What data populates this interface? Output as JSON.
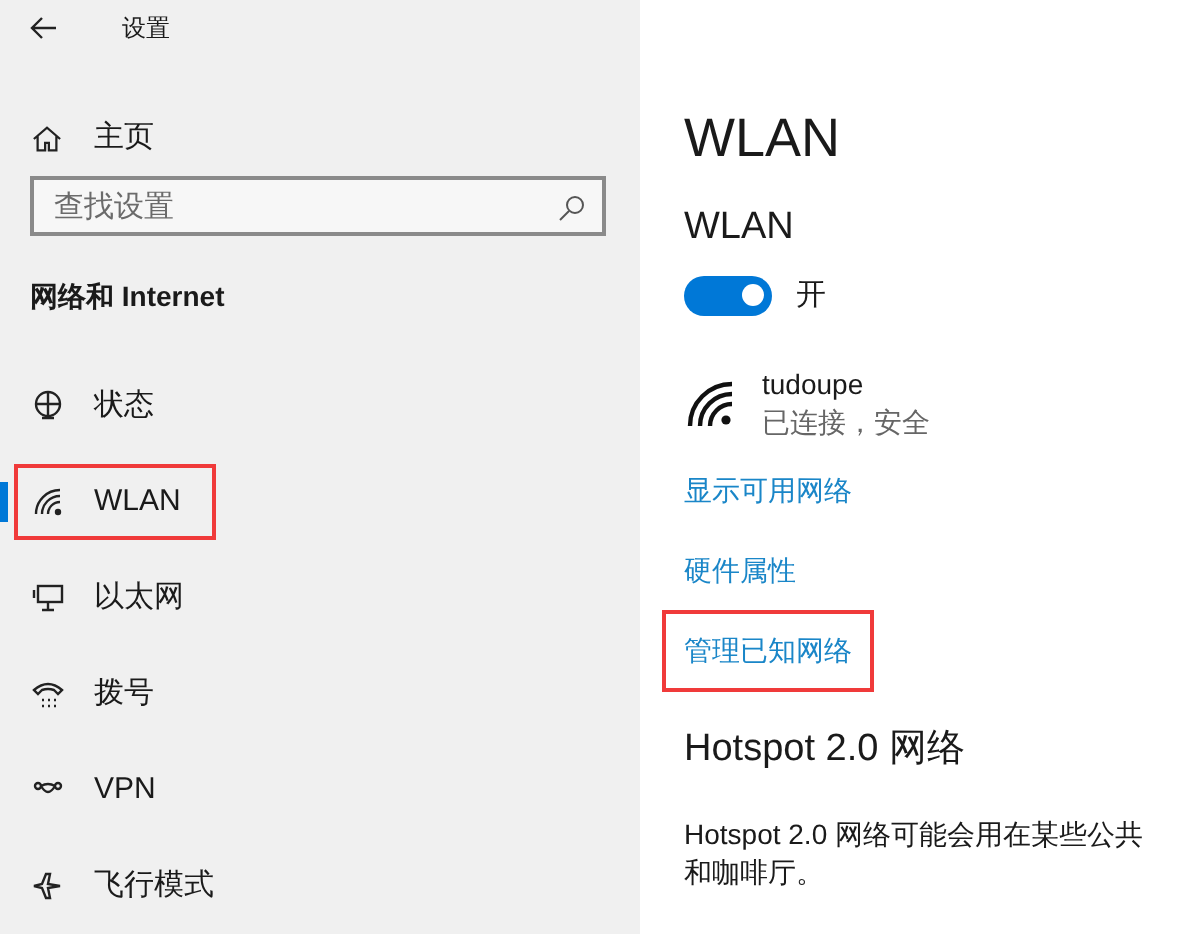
{
  "window": {
    "title": "设置"
  },
  "sidebar": {
    "home": "主页",
    "search": {
      "placeholder": "查找设置"
    },
    "section": "网络和 Internet",
    "items": [
      {
        "label": "状态",
        "kind": "status",
        "selected": false,
        "highlighted": false
      },
      {
        "label": "WLAN",
        "kind": "wifi",
        "selected": true,
        "highlighted": true
      },
      {
        "label": "以太网",
        "kind": "ethernet",
        "selected": false,
        "highlighted": false
      },
      {
        "label": "拨号",
        "kind": "dialup",
        "selected": false,
        "highlighted": false
      },
      {
        "label": "VPN",
        "kind": "vpn",
        "selected": false,
        "highlighted": false
      },
      {
        "label": "飞行模式",
        "kind": "airplane",
        "selected": false,
        "highlighted": false
      }
    ]
  },
  "content": {
    "title": "WLAN",
    "wlan": {
      "heading": "WLAN",
      "on": true,
      "state_label": "开"
    },
    "network": {
      "name": "tudoupe",
      "status": "已连接，安全"
    },
    "links": [
      {
        "label": "显示可用网络",
        "highlighted": false
      },
      {
        "label": "硬件属性",
        "highlighted": false
      },
      {
        "label": "管理已知网络",
        "highlighted": true
      }
    ],
    "hotspot": {
      "heading": "Hotspot 2.0 网络",
      "lines": [
        "Hotspot 2.0 网络可能会用在某些公共",
        "和咖啡厅。"
      ]
    }
  }
}
